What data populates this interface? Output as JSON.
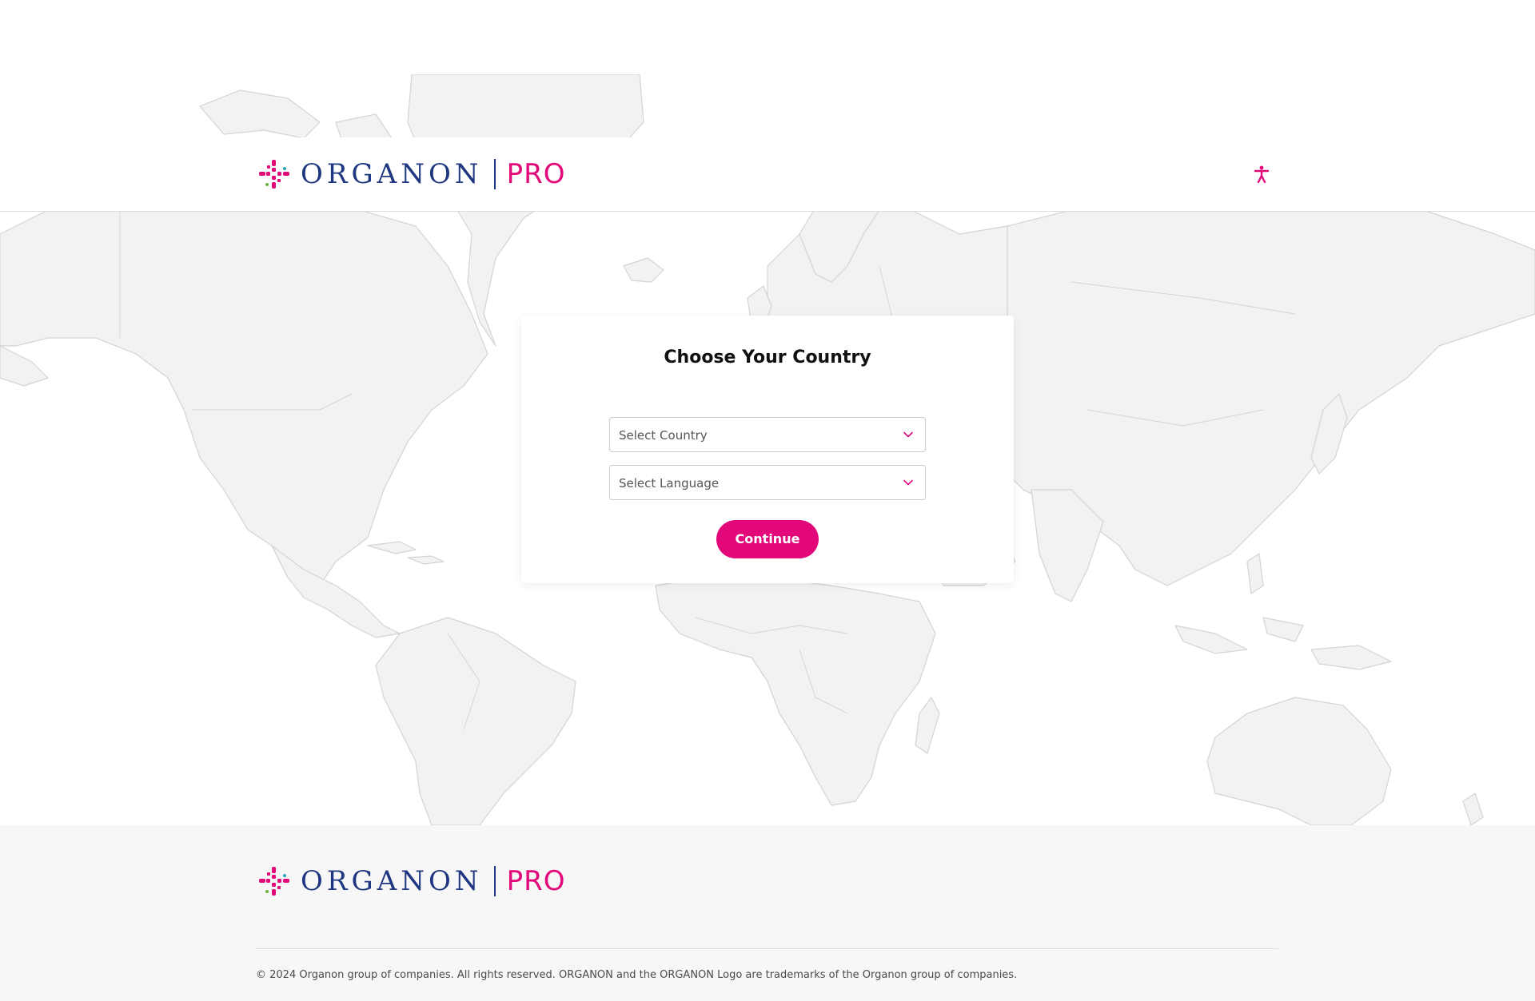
{
  "header": {
    "logo_text": "ORGANON",
    "logo_suffix": "PRO",
    "accessibility_icon": "accessibility-icon"
  },
  "modal": {
    "title": "Choose Your Country",
    "country_select": {
      "placeholder": "Select Country",
      "icon": "chevron-down-icon"
    },
    "language_select": {
      "placeholder": "Select Language",
      "icon": "chevron-down-icon"
    },
    "continue_label": "Continue"
  },
  "footer": {
    "logo_text": "ORGANON",
    "logo_suffix": "PRO",
    "copyright": "© 2024 Organon group of companies. All rights reserved. ORGANON and the ORGANON Logo are trademarks of the Organon group of companies."
  },
  "colors": {
    "brand_pink": "#e2087a",
    "brand_navy": "#1f3680",
    "map_fill": "#f2f2f2",
    "map_stroke": "#cfcfcf",
    "footer_bg": "#f7f7f7"
  }
}
